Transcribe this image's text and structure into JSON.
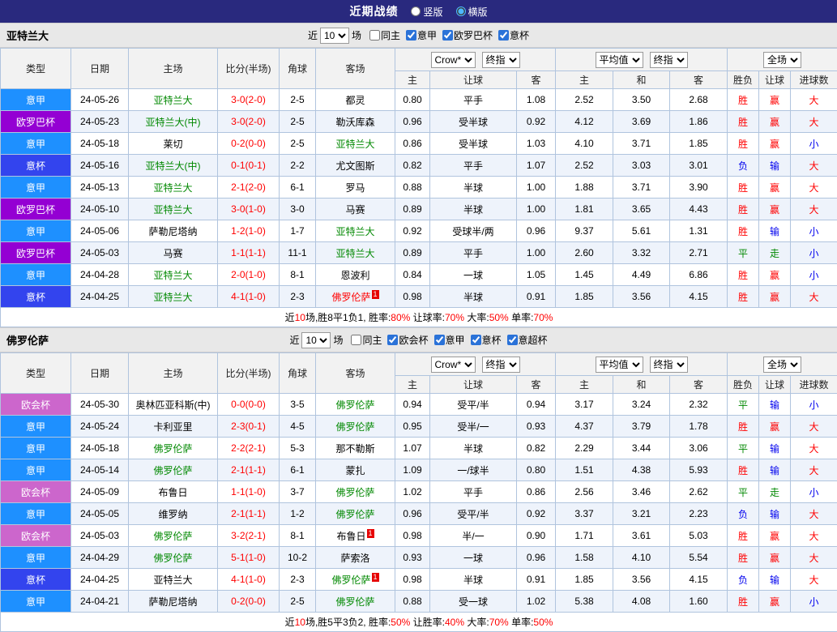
{
  "topbar": {
    "title": "近期战绩",
    "radio_vertical": "竖版",
    "radio_horizontal": "横版",
    "vertical_selected": false,
    "horizontal_selected": true
  },
  "controls": {
    "recent_prefix": "近",
    "recent_value": "10",
    "recent_suffix": "场",
    "crow_select": "Crow*",
    "final_select": "终指",
    "avg_select": "平均值",
    "fulltime_select": "全场"
  },
  "columns": {
    "league": "类型",
    "date": "日期",
    "home": "主场",
    "score": "比分(半场)",
    "corner": "角球",
    "away": "客场",
    "odds_home": "主",
    "odds_handicap": "让球",
    "odds_away": "客",
    "avg_home": "主",
    "avg_draw": "和",
    "avg_away": "客",
    "res_wdl": "胜负",
    "res_handicap": "让球",
    "res_goals": "进球数"
  },
  "colors": {
    "red": "#ff0000",
    "blue": "#0000ee",
    "green": "#008800",
    "black": "#000000",
    "score": "#ff0000",
    "leagues": {
      "意甲": "#1e90ff",
      "欧罗巴杯": "#9400d3",
      "意杯": "#3344ee",
      "欧会杯": "#cc66cc"
    }
  },
  "sections": [
    {
      "team": "亚特兰大",
      "filters": [
        {
          "label": "同主",
          "checked": false
        },
        {
          "label": "意甲",
          "checked": true
        },
        {
          "label": "欧罗巴杯",
          "checked": true
        },
        {
          "label": "意杯",
          "checked": true
        }
      ],
      "rows": [
        {
          "league": "意甲",
          "date": "24-05-26",
          "home": {
            "text": "亚特兰大",
            "color": "green"
          },
          "score": "3-0(2-0)",
          "corner": "2-5",
          "away": {
            "text": "都灵",
            "color": "black"
          },
          "odds": [
            "0.80",
            "平手",
            "1.08"
          ],
          "avg": [
            "2.52",
            "3.50",
            "2.68"
          ],
          "results": [
            {
              "text": "胜",
              "color": "red"
            },
            {
              "text": "赢",
              "color": "red"
            },
            {
              "text": "大",
              "color": "red"
            }
          ]
        },
        {
          "league": "欧罗巴杯",
          "date": "24-05-23",
          "home": {
            "text": "亚特兰大(中)",
            "color": "green"
          },
          "score": "3-0(2-0)",
          "corner": "2-5",
          "away": {
            "text": "勒沃库森",
            "color": "black"
          },
          "odds": [
            "0.96",
            "受半球",
            "0.92"
          ],
          "avg": [
            "4.12",
            "3.69",
            "1.86"
          ],
          "results": [
            {
              "text": "胜",
              "color": "red"
            },
            {
              "text": "赢",
              "color": "red"
            },
            {
              "text": "大",
              "color": "red"
            }
          ]
        },
        {
          "league": "意甲",
          "date": "24-05-18",
          "home": {
            "text": "莱切",
            "color": "black"
          },
          "score": "0-2(0-0)",
          "corner": "2-5",
          "away": {
            "text": "亚特兰大",
            "color": "green"
          },
          "odds": [
            "0.86",
            "受半球",
            "1.03"
          ],
          "avg": [
            "4.10",
            "3.71",
            "1.85"
          ],
          "results": [
            {
              "text": "胜",
              "color": "red"
            },
            {
              "text": "赢",
              "color": "red"
            },
            {
              "text": "小",
              "color": "blue"
            }
          ]
        },
        {
          "league": "意杯",
          "date": "24-05-16",
          "home": {
            "text": "亚特兰大(中)",
            "color": "green"
          },
          "score": "0-1(0-1)",
          "corner": "2-2",
          "away": {
            "text": "尤文图斯",
            "color": "black"
          },
          "odds": [
            "0.82",
            "平手",
            "1.07"
          ],
          "avg": [
            "2.52",
            "3.03",
            "3.01"
          ],
          "results": [
            {
              "text": "负",
              "color": "blue"
            },
            {
              "text": "输",
              "color": "blue"
            },
            {
              "text": "大",
              "color": "red"
            }
          ]
        },
        {
          "league": "意甲",
          "date": "24-05-13",
          "home": {
            "text": "亚特兰大",
            "color": "green"
          },
          "score": "2-1(2-0)",
          "corner": "6-1",
          "away": {
            "text": "罗马",
            "color": "black"
          },
          "odds": [
            "0.88",
            "半球",
            "1.00"
          ],
          "avg": [
            "1.88",
            "3.71",
            "3.90"
          ],
          "results": [
            {
              "text": "胜",
              "color": "red"
            },
            {
              "text": "赢",
              "color": "red"
            },
            {
              "text": "大",
              "color": "red"
            }
          ]
        },
        {
          "league": "欧罗巴杯",
          "date": "24-05-10",
          "home": {
            "text": "亚特兰大",
            "color": "green"
          },
          "score": "3-0(1-0)",
          "corner": "3-0",
          "away": {
            "text": "马赛",
            "color": "black"
          },
          "odds": [
            "0.89",
            "半球",
            "1.00"
          ],
          "avg": [
            "1.81",
            "3.65",
            "4.43"
          ],
          "results": [
            {
              "text": "胜",
              "color": "red"
            },
            {
              "text": "赢",
              "color": "red"
            },
            {
              "text": "大",
              "color": "red"
            }
          ]
        },
        {
          "league": "意甲",
          "date": "24-05-06",
          "home": {
            "text": "萨勒尼塔纳",
            "color": "black"
          },
          "score": "1-2(1-0)",
          "corner": "1-7",
          "away": {
            "text": "亚特兰大",
            "color": "green"
          },
          "odds": [
            "0.92",
            "受球半/两",
            "0.96"
          ],
          "avg": [
            "9.37",
            "5.61",
            "1.31"
          ],
          "results": [
            {
              "text": "胜",
              "color": "red"
            },
            {
              "text": "输",
              "color": "blue"
            },
            {
              "text": "小",
              "color": "blue"
            }
          ]
        },
        {
          "league": "欧罗巴杯",
          "date": "24-05-03",
          "home": {
            "text": "马赛",
            "color": "black"
          },
          "score": "1-1(1-1)",
          "corner": "11-1",
          "away": {
            "text": "亚特兰大",
            "color": "green"
          },
          "odds": [
            "0.89",
            "平手",
            "1.00"
          ],
          "avg": [
            "2.60",
            "3.32",
            "2.71"
          ],
          "results": [
            {
              "text": "平",
              "color": "green"
            },
            {
              "text": "走",
              "color": "green"
            },
            {
              "text": "小",
              "color": "blue"
            }
          ]
        },
        {
          "league": "意甲",
          "date": "24-04-28",
          "home": {
            "text": "亚特兰大",
            "color": "green"
          },
          "score": "2-0(1-0)",
          "corner": "8-1",
          "away": {
            "text": "恩波利",
            "color": "black"
          },
          "odds": [
            "0.84",
            "一球",
            "1.05"
          ],
          "avg": [
            "1.45",
            "4.49",
            "6.86"
          ],
          "results": [
            {
              "text": "胜",
              "color": "red"
            },
            {
              "text": "赢",
              "color": "red"
            },
            {
              "text": "小",
              "color": "blue"
            }
          ]
        },
        {
          "league": "意杯",
          "date": "24-04-25",
          "home": {
            "text": "亚特兰大",
            "color": "green"
          },
          "score": "4-1(1-0)",
          "corner": "2-3",
          "away": {
            "text": "佛罗伦萨",
            "color": "red",
            "mark": "1"
          },
          "odds": [
            "0.98",
            "半球",
            "0.91"
          ],
          "avg": [
            "1.85",
            "3.56",
            "4.15"
          ],
          "results": [
            {
              "text": "胜",
              "color": "red"
            },
            {
              "text": "赢",
              "color": "red"
            },
            {
              "text": "大",
              "color": "red"
            }
          ]
        }
      ],
      "summary": [
        {
          "text": "近",
          "color": "#000000"
        },
        {
          "text": "10",
          "color": "#ff0000"
        },
        {
          "text": "场,胜8平1负1, 胜率:",
          "color": "#000000"
        },
        {
          "text": "80%",
          "color": "#ff0000"
        },
        {
          "text": " 让球率:",
          "color": "#000000"
        },
        {
          "text": "70%",
          "color": "#ff0000"
        },
        {
          "text": " 大率:",
          "color": "#000000"
        },
        {
          "text": "50%",
          "color": "#ff0000"
        },
        {
          "text": " 单率:",
          "color": "#000000"
        },
        {
          "text": "70%",
          "color": "#ff0000"
        }
      ]
    },
    {
      "team": "佛罗伦萨",
      "filters": [
        {
          "label": "同主",
          "checked": false
        },
        {
          "label": "欧会杯",
          "checked": true
        },
        {
          "label": "意甲",
          "checked": true
        },
        {
          "label": "意杯",
          "checked": true
        },
        {
          "label": "意超杯",
          "checked": true
        }
      ],
      "rows": [
        {
          "league": "欧会杯",
          "date": "24-05-30",
          "home": {
            "text": "奥林匹亚科斯(中)",
            "color": "black"
          },
          "score": "0-0(0-0)",
          "corner": "3-5",
          "away": {
            "text": "佛罗伦萨",
            "color": "green"
          },
          "odds": [
            "0.94",
            "受平/半",
            "0.94"
          ],
          "avg": [
            "3.17",
            "3.24",
            "2.32"
          ],
          "results": [
            {
              "text": "平",
              "color": "green"
            },
            {
              "text": "输",
              "color": "blue"
            },
            {
              "text": "小",
              "color": "blue"
            }
          ]
        },
        {
          "league": "意甲",
          "date": "24-05-24",
          "home": {
            "text": "卡利亚里",
            "color": "black"
          },
          "score": "2-3(0-1)",
          "corner": "4-5",
          "away": {
            "text": "佛罗伦萨",
            "color": "green"
          },
          "odds": [
            "0.95",
            "受半/一",
            "0.93"
          ],
          "avg": [
            "4.37",
            "3.79",
            "1.78"
          ],
          "results": [
            {
              "text": "胜",
              "color": "red"
            },
            {
              "text": "赢",
              "color": "red"
            },
            {
              "text": "大",
              "color": "red"
            }
          ]
        },
        {
          "league": "意甲",
          "date": "24-05-18",
          "home": {
            "text": "佛罗伦萨",
            "color": "green"
          },
          "score": "2-2(2-1)",
          "corner": "5-3",
          "away": {
            "text": "那不勒斯",
            "color": "black"
          },
          "odds": [
            "1.07",
            "半球",
            "0.82"
          ],
          "avg": [
            "2.29",
            "3.44",
            "3.06"
          ],
          "results": [
            {
              "text": "平",
              "color": "green"
            },
            {
              "text": "输",
              "color": "blue"
            },
            {
              "text": "大",
              "color": "red"
            }
          ]
        },
        {
          "league": "意甲",
          "date": "24-05-14",
          "home": {
            "text": "佛罗伦萨",
            "color": "green"
          },
          "score": "2-1(1-1)",
          "corner": "6-1",
          "away": {
            "text": "蒙扎",
            "color": "black"
          },
          "odds": [
            "1.09",
            "一/球半",
            "0.80"
          ],
          "avg": [
            "1.51",
            "4.38",
            "5.93"
          ],
          "results": [
            {
              "text": "胜",
              "color": "red"
            },
            {
              "text": "输",
              "color": "blue"
            },
            {
              "text": "大",
              "color": "red"
            }
          ]
        },
        {
          "league": "欧会杯",
          "date": "24-05-09",
          "home": {
            "text": "布鲁日",
            "color": "black"
          },
          "score": "1-1(1-0)",
          "corner": "3-7",
          "away": {
            "text": "佛罗伦萨",
            "color": "green"
          },
          "odds": [
            "1.02",
            "平手",
            "0.86"
          ],
          "avg": [
            "2.56",
            "3.46",
            "2.62"
          ],
          "results": [
            {
              "text": "平",
              "color": "green"
            },
            {
              "text": "走",
              "color": "green"
            },
            {
              "text": "小",
              "color": "blue"
            }
          ]
        },
        {
          "league": "意甲",
          "date": "24-05-05",
          "home": {
            "text": "维罗纳",
            "color": "black"
          },
          "score": "2-1(1-1)",
          "corner": "1-2",
          "away": {
            "text": "佛罗伦萨",
            "color": "green"
          },
          "odds": [
            "0.96",
            "受平/半",
            "0.92"
          ],
          "avg": [
            "3.37",
            "3.21",
            "2.23"
          ],
          "results": [
            {
              "text": "负",
              "color": "blue"
            },
            {
              "text": "输",
              "color": "blue"
            },
            {
              "text": "大",
              "color": "red"
            }
          ]
        },
        {
          "league": "欧会杯",
          "date": "24-05-03",
          "home": {
            "text": "佛罗伦萨",
            "color": "green"
          },
          "score": "3-2(2-1)",
          "corner": "8-1",
          "away": {
            "text": "布鲁日",
            "color": "black",
            "mark": "1"
          },
          "odds": [
            "0.98",
            "半/一",
            "0.90"
          ],
          "avg": [
            "1.71",
            "3.61",
            "5.03"
          ],
          "results": [
            {
              "text": "胜",
              "color": "red"
            },
            {
              "text": "赢",
              "color": "red"
            },
            {
              "text": "大",
              "color": "red"
            }
          ]
        },
        {
          "league": "意甲",
          "date": "24-04-29",
          "home": {
            "text": "佛罗伦萨",
            "color": "green"
          },
          "score": "5-1(1-0)",
          "corner": "10-2",
          "away": {
            "text": "萨索洛",
            "color": "black"
          },
          "odds": [
            "0.93",
            "一球",
            "0.96"
          ],
          "avg": [
            "1.58",
            "4.10",
            "5.54"
          ],
          "results": [
            {
              "text": "胜",
              "color": "red"
            },
            {
              "text": "赢",
              "color": "red"
            },
            {
              "text": "大",
              "color": "red"
            }
          ]
        },
        {
          "league": "意杯",
          "date": "24-04-25",
          "home": {
            "text": "亚特兰大",
            "color": "black"
          },
          "score": "4-1(1-0)",
          "corner": "2-3",
          "away": {
            "text": "佛罗伦萨",
            "color": "green",
            "mark": "1"
          },
          "odds": [
            "0.98",
            "半球",
            "0.91"
          ],
          "avg": [
            "1.85",
            "3.56",
            "4.15"
          ],
          "results": [
            {
              "text": "负",
              "color": "blue"
            },
            {
              "text": "输",
              "color": "blue"
            },
            {
              "text": "大",
              "color": "red"
            }
          ]
        },
        {
          "league": "意甲",
          "date": "24-04-21",
          "home": {
            "text": "萨勒尼塔纳",
            "color": "black"
          },
          "score": "0-2(0-0)",
          "corner": "2-5",
          "away": {
            "text": "佛罗伦萨",
            "color": "green"
          },
          "odds": [
            "0.88",
            "受一球",
            "1.02"
          ],
          "avg": [
            "5.38",
            "4.08",
            "1.60"
          ],
          "results": [
            {
              "text": "胜",
              "color": "red"
            },
            {
              "text": "赢",
              "color": "red"
            },
            {
              "text": "小",
              "color": "blue"
            }
          ]
        }
      ],
      "summary": [
        {
          "text": "近",
          "color": "#000000"
        },
        {
          "text": "10",
          "color": "#ff0000"
        },
        {
          "text": "场,胜5平3负2, 胜率:",
          "color": "#000000"
        },
        {
          "text": "50%",
          "color": "#ff0000"
        },
        {
          "text": " 让胜率:",
          "color": "#000000"
        },
        {
          "text": "40%",
          "color": "#ff0000"
        },
        {
          "text": " 大率:",
          "color": "#000000"
        },
        {
          "text": "70%",
          "color": "#ff0000"
        },
        {
          "text": " 单率:",
          "color": "#000000"
        },
        {
          "text": "50%",
          "color": "#ff0000"
        }
      ]
    }
  ]
}
